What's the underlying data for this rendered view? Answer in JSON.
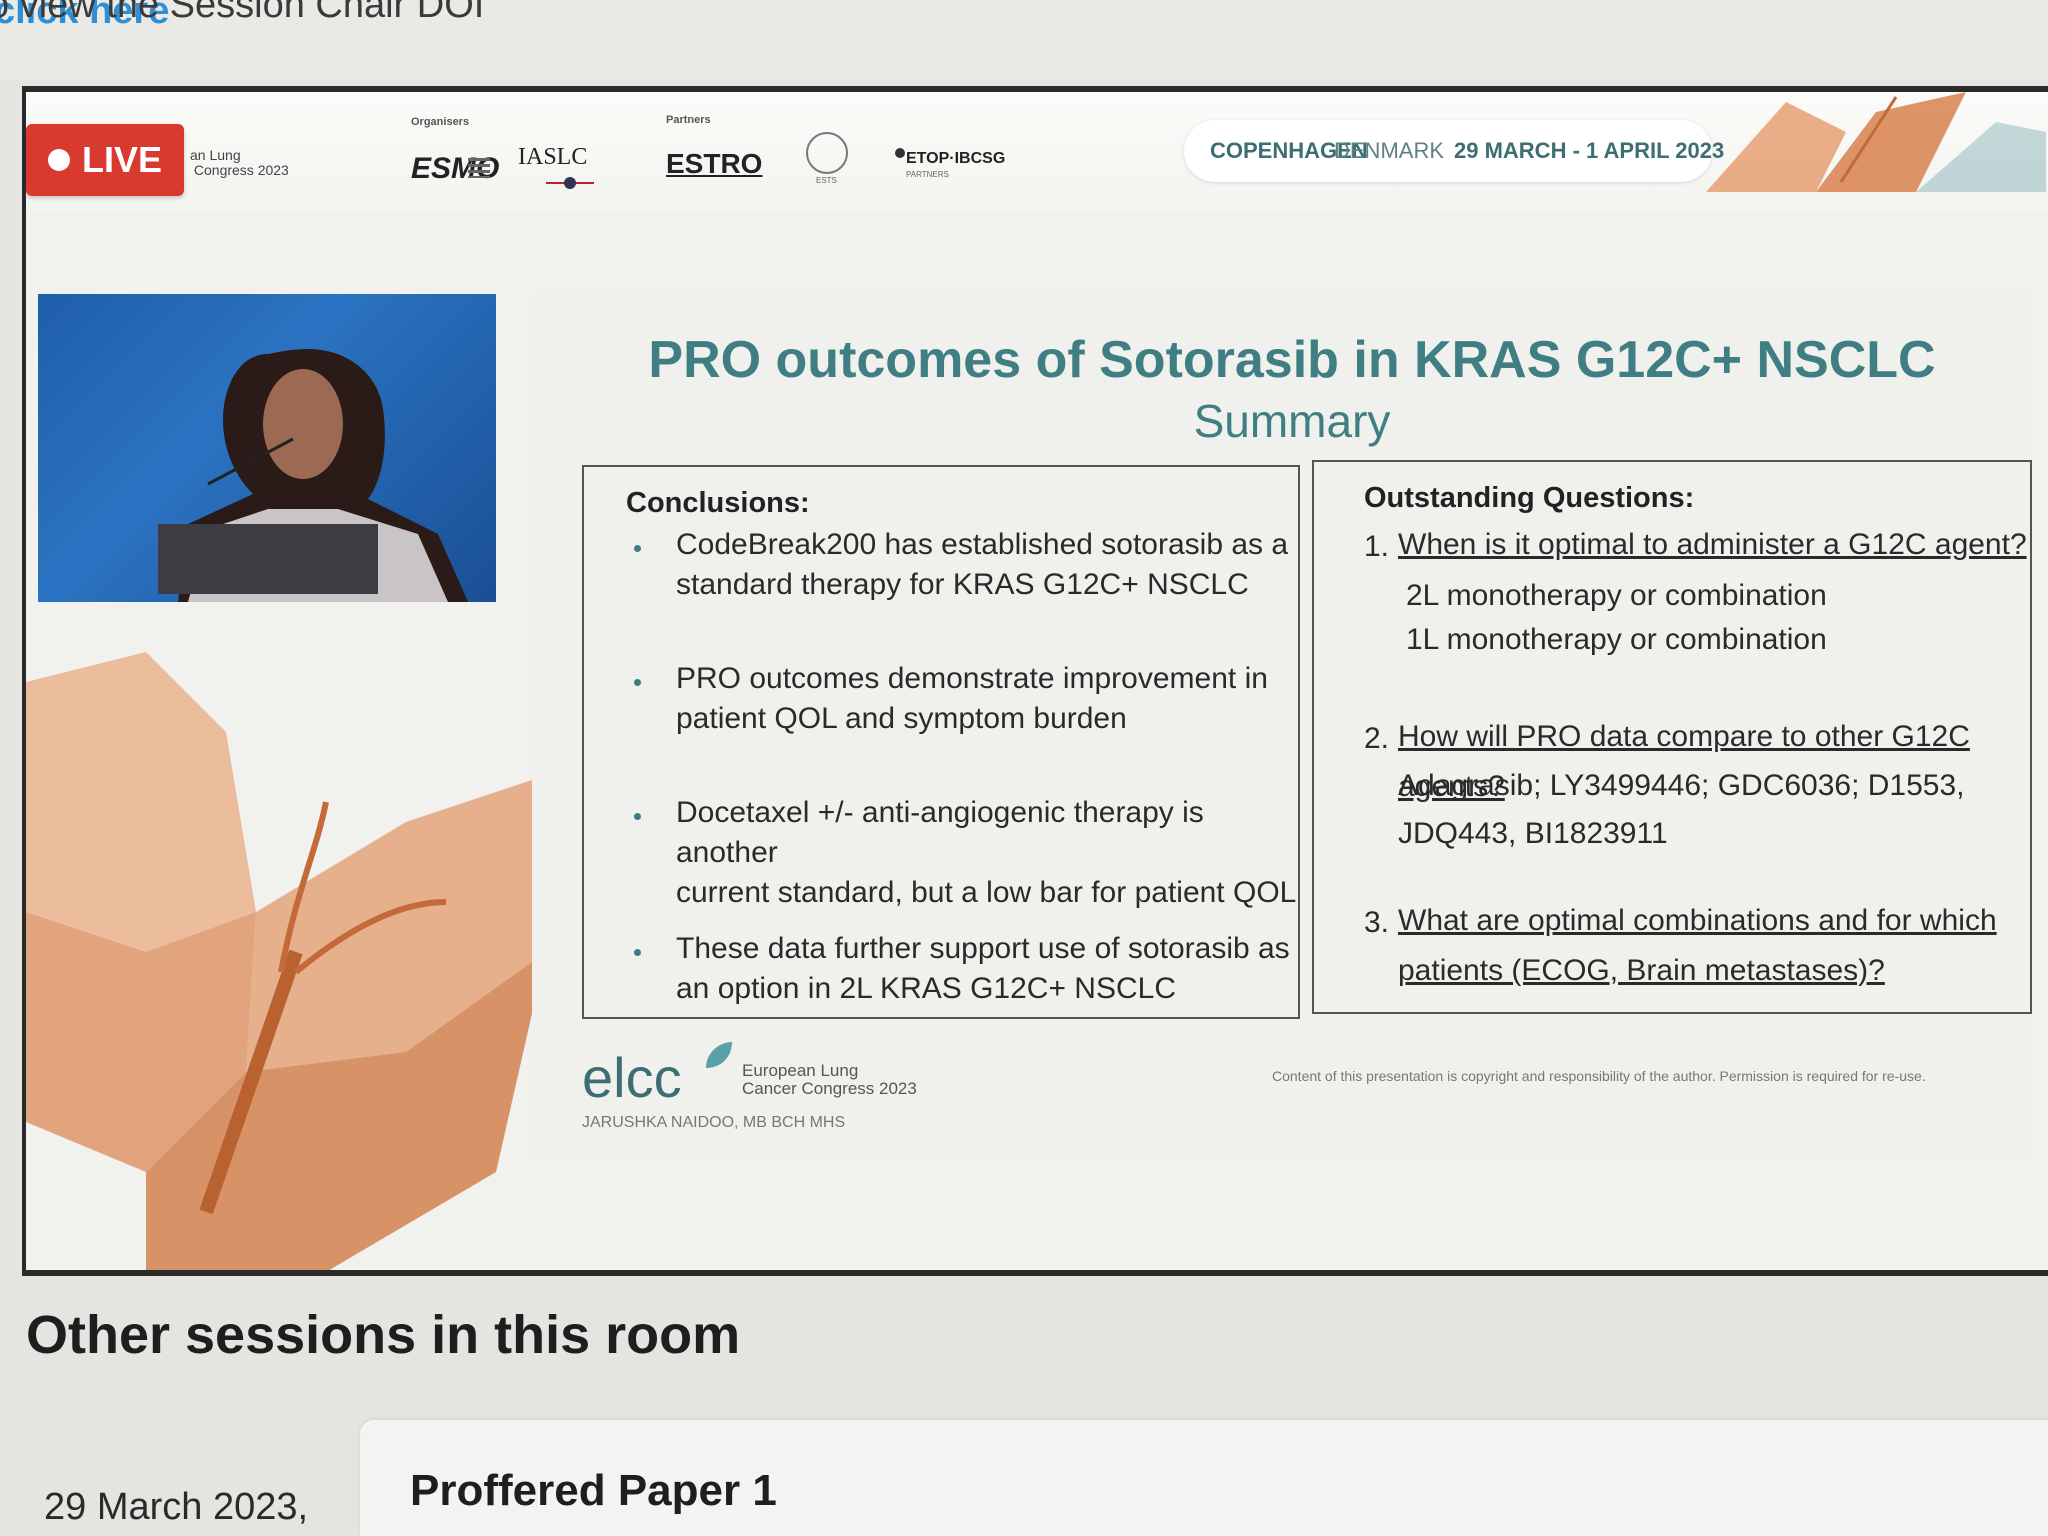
{
  "notice": {
    "prefix": "o view the Session Chair DOI",
    "link": "click here"
  },
  "banner": {
    "live_label": "LIVE",
    "congress_small": "an Lung\n Congress 2023",
    "organisers_label": "Organisers",
    "partners_label": "Partners",
    "logos": {
      "esmo": "ESMO",
      "iaslc": "IASLC",
      "estro": "ESTRO",
      "ests": "ESTS",
      "etop": "ETOP·IBCSG",
      "etop_sub": "PARTNERS"
    },
    "location": {
      "city": "COPENHAGEN",
      "country": "DENMARK",
      "dates": "29 MARCH - 1 APRIL 2023"
    }
  },
  "slide": {
    "title": "PRO outcomes of Sotorasib in KRAS G12C+ NSCLC",
    "subtitle": "Summary",
    "conclusions": {
      "heading": "Conclusions:",
      "items": [
        {
          "line1": "CodeBreak200 has established sotorasib as a",
          "line2": "standard therapy for KRAS G12C+ NSCLC"
        },
        {
          "line1": "PRO outcomes demonstrate improvement in",
          "line2": "patient QOL and symptom burden"
        },
        {
          "line1": "Docetaxel +/- anti-angiogenic therapy is another",
          "line2": "current standard, but a low bar for patient QOL"
        },
        {
          "line1": "These data further support use of sotorasib as",
          "line2": "an option in 2L KRAS G12C+ NSCLC"
        }
      ]
    },
    "questions": {
      "heading": "Outstanding Questions:",
      "items": [
        {
          "num": "1.",
          "q": "When is it optimal to administer a G12C agent?",
          "subs": [
            "2L monotherapy or combination",
            "1L monotherapy or combination"
          ]
        },
        {
          "num": "2.",
          "q": "How will PRO data compare to other G12C agents?",
          "subs": [
            "Adagrasib; LY3499446; GDC6036; D1553,",
            "JDQ443, BI1823911"
          ]
        },
        {
          "num": "3.",
          "q1": "What are optimal combinations and for which",
          "q2": "patients (ECOG, Brain metastases)?"
        }
      ]
    },
    "footer": {
      "logo": "elcc",
      "congress_name": "European Lung\nCancer Congress 2023",
      "copyright": "Content of this presentation is copyright and responsibility of the author. Permission is required for re-use.",
      "presenter": "JARUSHKA NAIDOO, MB BCH MHS"
    }
  },
  "other_sessions": {
    "heading": "Other sessions in this room",
    "sessions": [
      {
        "date": "29 March 2023,",
        "title": "Proffered Paper 1"
      }
    ]
  }
}
